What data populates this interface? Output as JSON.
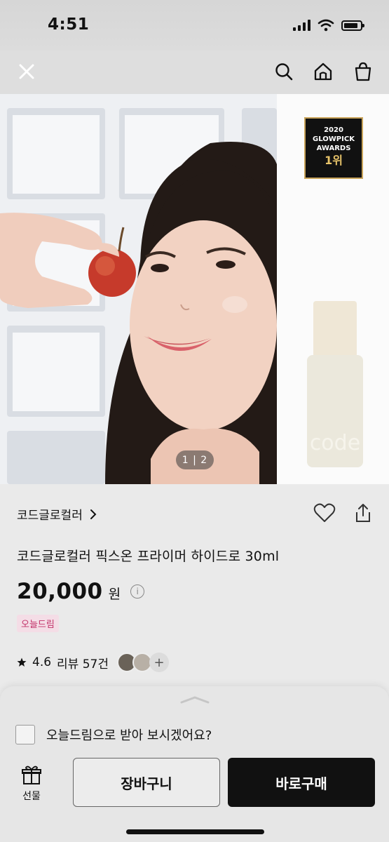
{
  "status_bar": {
    "time": "4:51",
    "battery_level": 0.85
  },
  "nav": {
    "icons": [
      "close-icon",
      "search-icon",
      "home-icon",
      "shopping-bag-icon"
    ]
  },
  "product_image": {
    "counter": "1 | 2",
    "award": {
      "year": "2020",
      "line1": "GLOWPICK",
      "line2": "AWARDS",
      "rank": "1위"
    },
    "bottle_text": "code"
  },
  "product": {
    "brand": "코드글로컬러",
    "name": "코드글로컬러 픽스온 프라이머 하이드로 30ml",
    "price": "20,000",
    "currency": "원",
    "badge": "오늘드림",
    "rating": "4.6",
    "reviews": "리뷰 57건"
  },
  "sheet": {
    "option_label": "오늘드림으로 받아 보시겠어요?",
    "gift_label": "선물",
    "cart_label": "장바구니",
    "buy_label": "바로구매"
  },
  "colors": {
    "badge_bg": "#f4dde6",
    "badge_text": "#c2326a",
    "buy_bg": "#111111",
    "award_gold": "#c9a45a"
  }
}
